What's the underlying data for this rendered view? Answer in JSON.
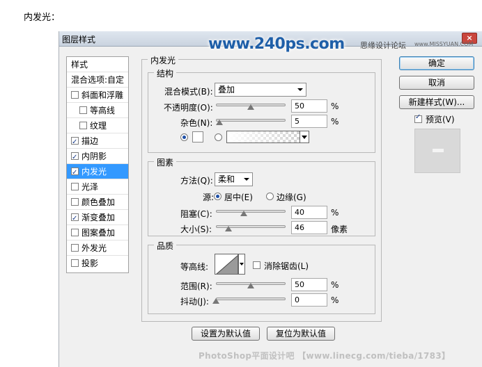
{
  "heading": "内发光：",
  "dialog": {
    "title": "图层样式",
    "close": "×",
    "watermark": "www.240ps.com",
    "corner_watermark": "思缘设计论坛",
    "corner_watermark2": "www.MISSYUAN.COM"
  },
  "sidebar": {
    "header": "样式",
    "blend_options": "混合选项:自定",
    "items": [
      {
        "label": "斜面和浮雕",
        "checked": false
      },
      {
        "label": "等高线",
        "checked": false
      },
      {
        "label": "纹理",
        "checked": false
      },
      {
        "label": "描边",
        "checked": true
      },
      {
        "label": "内阴影",
        "checked": true
      },
      {
        "label": "内发光",
        "checked": true
      },
      {
        "label": "光泽",
        "checked": false
      },
      {
        "label": "颜色叠加",
        "checked": false
      },
      {
        "label": "渐变叠加",
        "checked": true
      },
      {
        "label": "图案叠加",
        "checked": false
      },
      {
        "label": "外发光",
        "checked": false
      },
      {
        "label": "投影",
        "checked": false
      }
    ]
  },
  "panel": {
    "title": "内发光",
    "structure": {
      "legend": "结构",
      "blend_mode_label": "混合模式(B):",
      "blend_mode_value": "叠加",
      "opacity_label": "不透明度(O):",
      "opacity_value": "50",
      "opacity": 50,
      "noise_label": "杂色(N):",
      "noise_value": "5",
      "noise": 5,
      "unit": "%"
    },
    "elements": {
      "legend": "图素",
      "technique_label": "方法(Q):",
      "technique_value": "柔和",
      "source_label": "源:",
      "source_center": "居中(E)",
      "source_edge": "边缘(G)",
      "choke_label": "阻塞(C):",
      "choke_value": "40",
      "choke": 40,
      "size_label": "大小(S):",
      "size_value": "46",
      "size": 46,
      "size_unit": "像素",
      "unit": "%"
    },
    "quality": {
      "legend": "品质",
      "contour_label": "等高线:",
      "antialias_label": "消除锯齿(L)",
      "range_label": "范围(R):",
      "range_value": "50",
      "range": 50,
      "jitter_label": "抖动(J):",
      "jitter_value": "0",
      "jitter": 0,
      "unit": "%"
    },
    "make_default": "设置为默认值",
    "reset_default": "复位为默认值"
  },
  "buttons": {
    "ok": "确定",
    "cancel": "取消",
    "new_style": "新建样式(W)...",
    "preview_label": "预览(V)"
  },
  "footer_watermark": "PhotoShop平面设计吧 【www.linecg.com/tieba/1783】"
}
